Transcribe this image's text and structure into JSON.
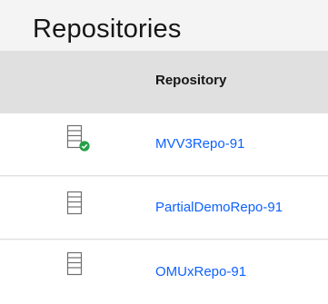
{
  "page": {
    "title": "Repositories"
  },
  "table": {
    "columns": [
      {
        "key": "icon",
        "label": ""
      },
      {
        "key": "repository",
        "label": "Repository"
      }
    ],
    "rows": [
      {
        "repository": "MVV3Repo-91",
        "icon": "repository-icon",
        "status_icon": "check-circle-icon",
        "status_color": "#24a148"
      },
      {
        "repository": "PartialDemoRepo-91",
        "icon": "repository-icon"
      },
      {
        "repository": "OMUxRepo-91",
        "icon": "repository-icon"
      }
    ]
  },
  "colors": {
    "link": "#0f62fe",
    "header_bg": "#e0e0e0",
    "status_ok": "#24a148"
  }
}
